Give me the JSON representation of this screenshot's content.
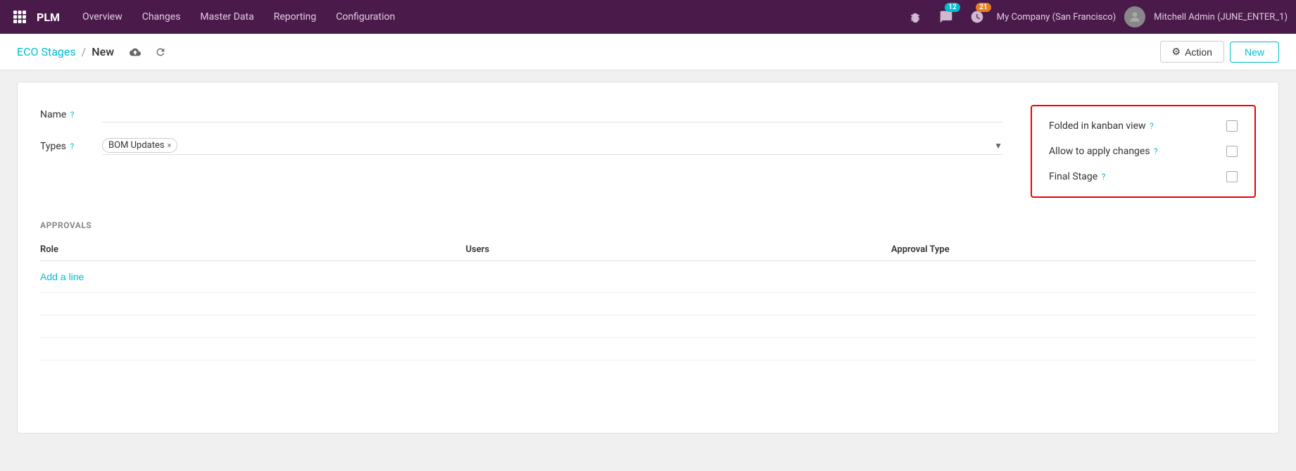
{
  "topnav": {
    "apps_icon": "⊞",
    "brand": "PLM",
    "menu_items": [
      "Overview",
      "Changes",
      "Master Data",
      "Reporting",
      "Configuration"
    ],
    "notifications_count": "12",
    "activities_count": "21",
    "company": "My Company (San Francisco)",
    "user": "Mitchell Admin (JUNE_ENTER_1)"
  },
  "breadcrumb": {
    "parent": "ECO Stages",
    "separator": "/",
    "current": "New",
    "action_label": "Action",
    "new_label": "New",
    "gear_icon": "⚙",
    "upload_icon": "☁",
    "refresh_icon": "↺"
  },
  "form": {
    "name_label": "Name",
    "name_help": "?",
    "types_label": "Types",
    "types_help": "?",
    "type_tag": "BOM Updates",
    "type_tag_remove": "×",
    "folded_label": "Folded in kanban view",
    "folded_help": "?",
    "allow_label": "Allow to apply changes",
    "allow_help": "?",
    "final_label": "Final Stage",
    "final_help": "?"
  },
  "approvals": {
    "section_title": "APPROVALS",
    "col_role": "Role",
    "col_users": "Users",
    "col_approval_type": "Approval Type",
    "add_line": "Add a line"
  },
  "colors": {
    "accent": "#00bcd4",
    "nav_bg": "#4a1a4a",
    "highlight_border": "#e00000"
  }
}
